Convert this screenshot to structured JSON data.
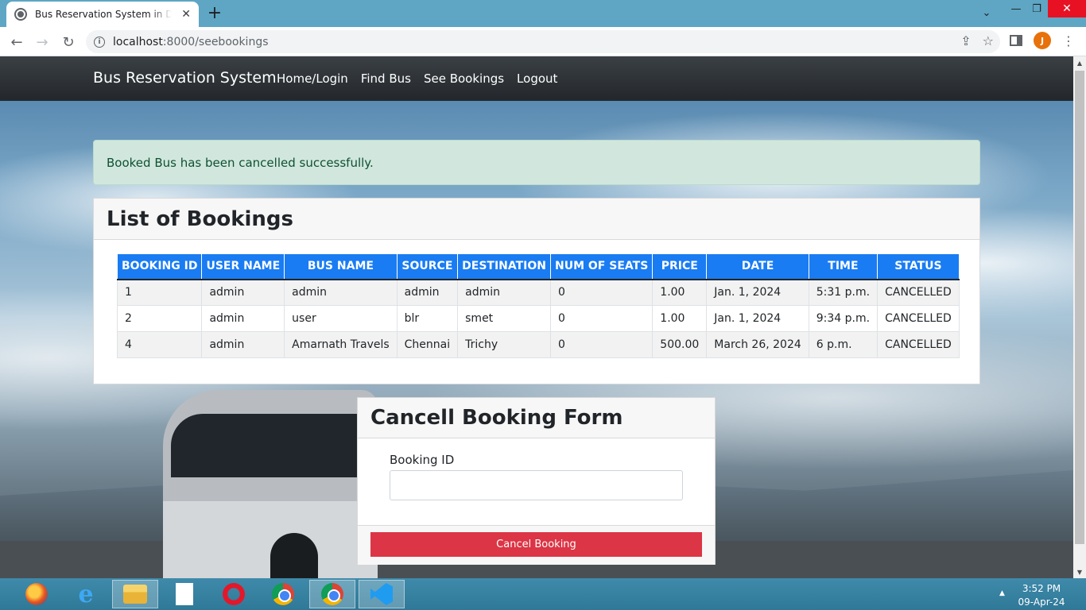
{
  "browser": {
    "tab_title": "Bus Reservation System in Django",
    "url_host": "localhost",
    "url_path": ":8000/seebookings",
    "profile_initial": "J"
  },
  "navbar": {
    "brand": "Bus Reservation System",
    "links": [
      "Home/Login",
      "Find Bus",
      "See Bookings",
      "Logout"
    ]
  },
  "alert": {
    "message": "Booked Bus has been cancelled successfully."
  },
  "bookings": {
    "title": "List of Bookings",
    "columns": [
      "BOOKING ID",
      "USER NAME",
      "BUS NAME",
      "SOURCE",
      "DESTINATION",
      "NUM OF SEATS",
      "PRICE",
      "DATE",
      "TIME",
      "STATUS"
    ],
    "rows": [
      [
        "1",
        "admin",
        "admin",
        "admin",
        "admin",
        "0",
        "1.00",
        "Jan. 1, 2024",
        "5:31 p.m.",
        "CANCELLED"
      ],
      [
        "2",
        "admin",
        "user",
        "blr",
        "smet",
        "0",
        "1.00",
        "Jan. 1, 2024",
        "9:34 p.m.",
        "CANCELLED"
      ],
      [
        "4",
        "admin",
        "Amarnath Travels",
        "Chennai",
        "Trichy",
        "0",
        "500.00",
        "March 26, 2024",
        "6 p.m.",
        "CANCELLED"
      ]
    ]
  },
  "cancel_form": {
    "title": "Cancell Booking Form",
    "field_label": "Booking ID",
    "field_value": "",
    "button_label": "Cancel Booking"
  },
  "taskbar": {
    "time": "3:52 PM",
    "date": "09-Apr-24"
  },
  "colors": {
    "table_header": "#1a7cf2",
    "danger": "#dc3545",
    "alert_bg": "#d1e7dd",
    "alert_text": "#0f5132"
  }
}
